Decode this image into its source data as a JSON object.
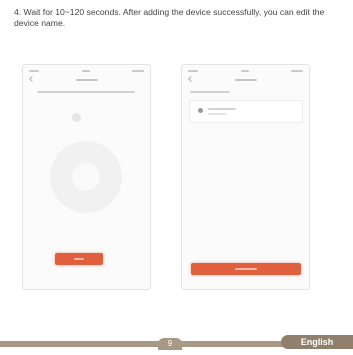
{
  "instruction": {
    "step_text": "4. Wait for 10~120 seconds. After adding the device successfully, you can edit the device name."
  },
  "footer": {
    "page_number": "9",
    "language": "English"
  },
  "colors": {
    "accent_button": "#e0603d",
    "footer_bar": "#a89986",
    "footer_lang_tab": "#8f7f6b"
  }
}
